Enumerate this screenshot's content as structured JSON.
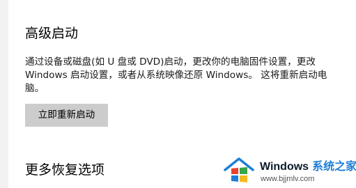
{
  "advanced_startup": {
    "title": "高级启动",
    "description_lines": [
      "通过设备或磁盘(如 U 盘或 DVD)启动，更改你的电脑固件设置，更改",
      "Windows 启动设置，或者从系统映像还原 Windows。 这将重新启动电",
      "脑。"
    ],
    "restart_button_label": "立即重新启动"
  },
  "more_recovery": {
    "title": "更多恢复选项"
  },
  "watermark": {
    "brand_part1": "Windows",
    "brand_part2": "系统之家",
    "url": "www.bjjmlv.com",
    "colors": {
      "accent": "#1e7fd6",
      "red": "#e8412c",
      "green": "#35a64a",
      "yellow": "#f5b81d",
      "blue": "#1e7fd6"
    }
  },
  "colors": {
    "button_bg": "#cccccc",
    "sidebar_strip": "#f2f2f2"
  }
}
